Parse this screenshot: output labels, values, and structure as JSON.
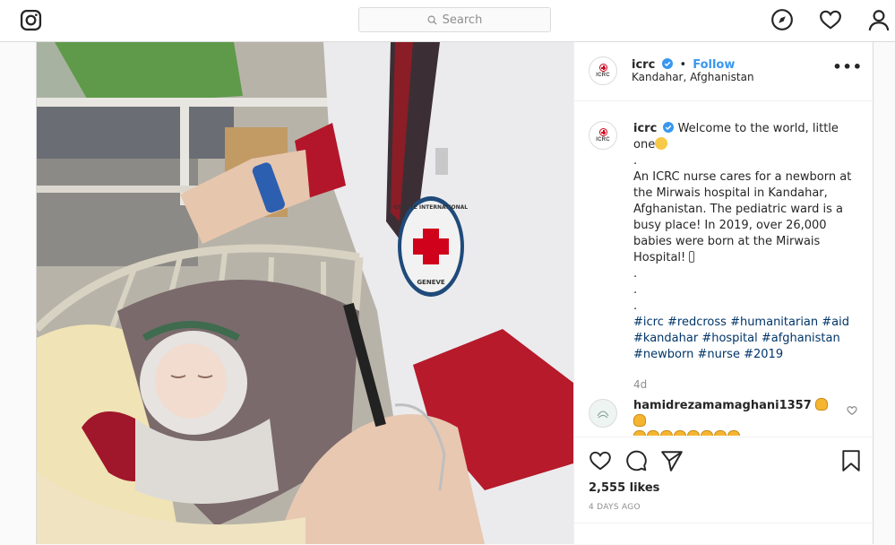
{
  "topbar": {
    "search_placeholder": "Search"
  },
  "post": {
    "username": "icrc",
    "follow_label": "Follow",
    "separator": "•",
    "location": "Kandahar, Afghanistan",
    "avatar_text": "ICRC",
    "more_label": "•••",
    "badge_text_top": "COMITE INTERNATIONAL",
    "badge_text_bottom": "GENEVE",
    "caption": {
      "username": "icrc",
      "line1": "Welcome to the world, little one",
      "dot1": ".",
      "body": "An ICRC nurse cares for a newborn at the Mirwais hospital in Kandahar, Afghanistan. The pediatric ward is a busy place! In 2019, over 26,000 babies were born at the Mirwais Hospital!",
      "dot2": ".",
      "dot3": ".",
      "dot4": ".",
      "hashtags": [
        "#icrc",
        "#redcross",
        "#humanitarian",
        "#aid",
        "#kandahar",
        "#hospital",
        "#afghanistan",
        "#newborn",
        "#nurse",
        "#2019"
      ],
      "age": "4d"
    },
    "comment": {
      "username": "hamidrezamamaghani1357"
    },
    "likes": "2,555 likes",
    "timestamp": "4 DAYS AGO"
  },
  "icons": {
    "logo": "instagram-icon",
    "search": "search-icon",
    "explore": "compass-icon",
    "activity": "heart-icon",
    "profile": "user-icon",
    "like": "heart-icon",
    "comment": "comment-icon",
    "share": "send-icon",
    "save": "bookmark-icon",
    "verified": "verified-badge-icon"
  },
  "colors": {
    "link_blue": "#3897f0",
    "hashtag": "#003569",
    "red_cross": "#d0021b",
    "border": "#dbdbdb"
  }
}
